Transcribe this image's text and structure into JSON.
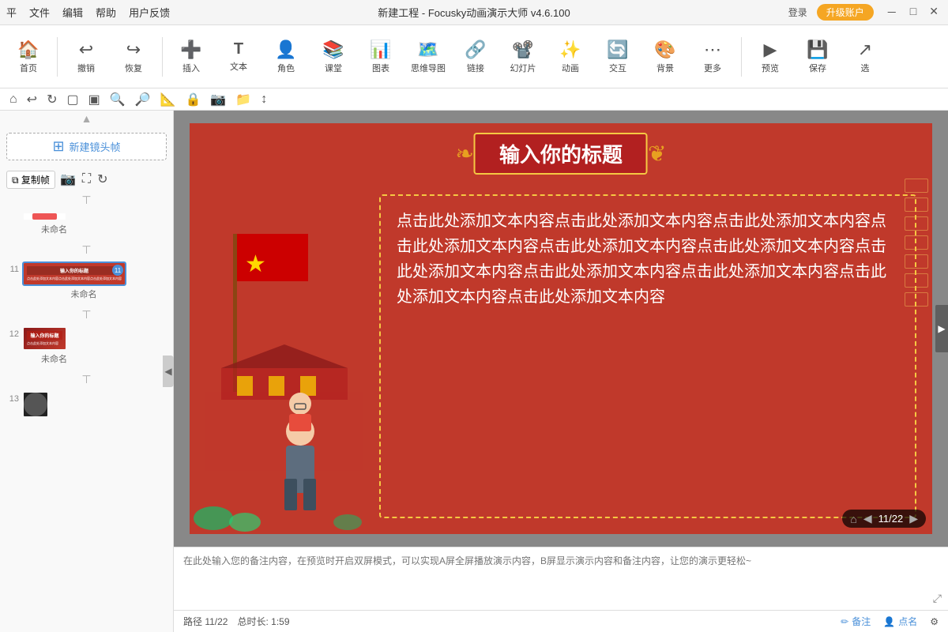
{
  "titlebar": {
    "menus": [
      "平",
      "文件",
      "编辑",
      "帮助",
      "用户反馈"
    ],
    "title": "新建工程 - Focusky动画演示大师 v4.6.100",
    "login": "登录",
    "upgrade": "升级账户",
    "win_min": "－",
    "win_max": "□",
    "win_close": "✕"
  },
  "toolbar": {
    "items": [
      {
        "icon": "🏠",
        "label": "首页"
      },
      {
        "icon": "↩",
        "label": "撤销"
      },
      {
        "icon": "↪",
        "label": "恢复"
      },
      {
        "icon": "＋",
        "label": "插入"
      },
      {
        "icon": "T",
        "label": "文本"
      },
      {
        "icon": "👤",
        "label": "角色"
      },
      {
        "icon": "📚",
        "label": "课堂"
      },
      {
        "icon": "📊",
        "label": "图表"
      },
      {
        "icon": "🗺",
        "label": "思维导图"
      },
      {
        "icon": "🔗",
        "label": "链接"
      },
      {
        "icon": "📽",
        "label": "幻灯片"
      },
      {
        "icon": "✨",
        "label": "动画"
      },
      {
        "icon": "🔄",
        "label": "交互"
      },
      {
        "icon": "🎨",
        "label": "背景"
      },
      {
        "icon": "⋯",
        "label": "更多"
      },
      {
        "icon": "▶",
        "label": "预览"
      },
      {
        "icon": "💾",
        "label": "保存"
      },
      {
        "icon": "→",
        "label": "选"
      }
    ]
  },
  "left_panel": {
    "new_frame": "新建镜头帧",
    "copy_frame": "复制帧",
    "slides": [
      {
        "number": "",
        "label": "未命名",
        "id": "s10"
      },
      {
        "number": "11",
        "label": "未命名",
        "id": "s11",
        "active": true,
        "badge": "11"
      },
      {
        "number": "12",
        "label": "未命名",
        "id": "s12"
      },
      {
        "number": "13",
        "label": "",
        "id": "s13"
      }
    ]
  },
  "canvas": {
    "slide_title": "输入你的标题",
    "text_content": "点击此处添加文本内容点击此处添加文本内容点击此处添加文本内容点击此处添加文本内容点击此处添加文本内容点击此处添加文本内容点击此处添加文本内容点击此处添加文本内容点击此处添加文本内容点击此处添加文本内容点击此处添加文本内容",
    "page_current": "11",
    "page_total": "22"
  },
  "bottom_note": {
    "placeholder": "在此处输入您的备注内容，在预览时开启双屏模式，可以实现A屏全屏播放演示内容，B屏显示演示内容和备注内容，让您的演示更轻松~"
  },
  "statusbar": {
    "path": "路径 11/22",
    "duration": "总时长: 1:59",
    "note_btn": "备注",
    "name_btn": "点名"
  },
  "icon_toolbar": {
    "icons": [
      "🏠",
      "↩",
      "↻",
      "⬜",
      "⬜",
      "🔍",
      "🔎",
      "📏",
      "🔒",
      "📷",
      "📁",
      "↕"
    ]
  }
}
